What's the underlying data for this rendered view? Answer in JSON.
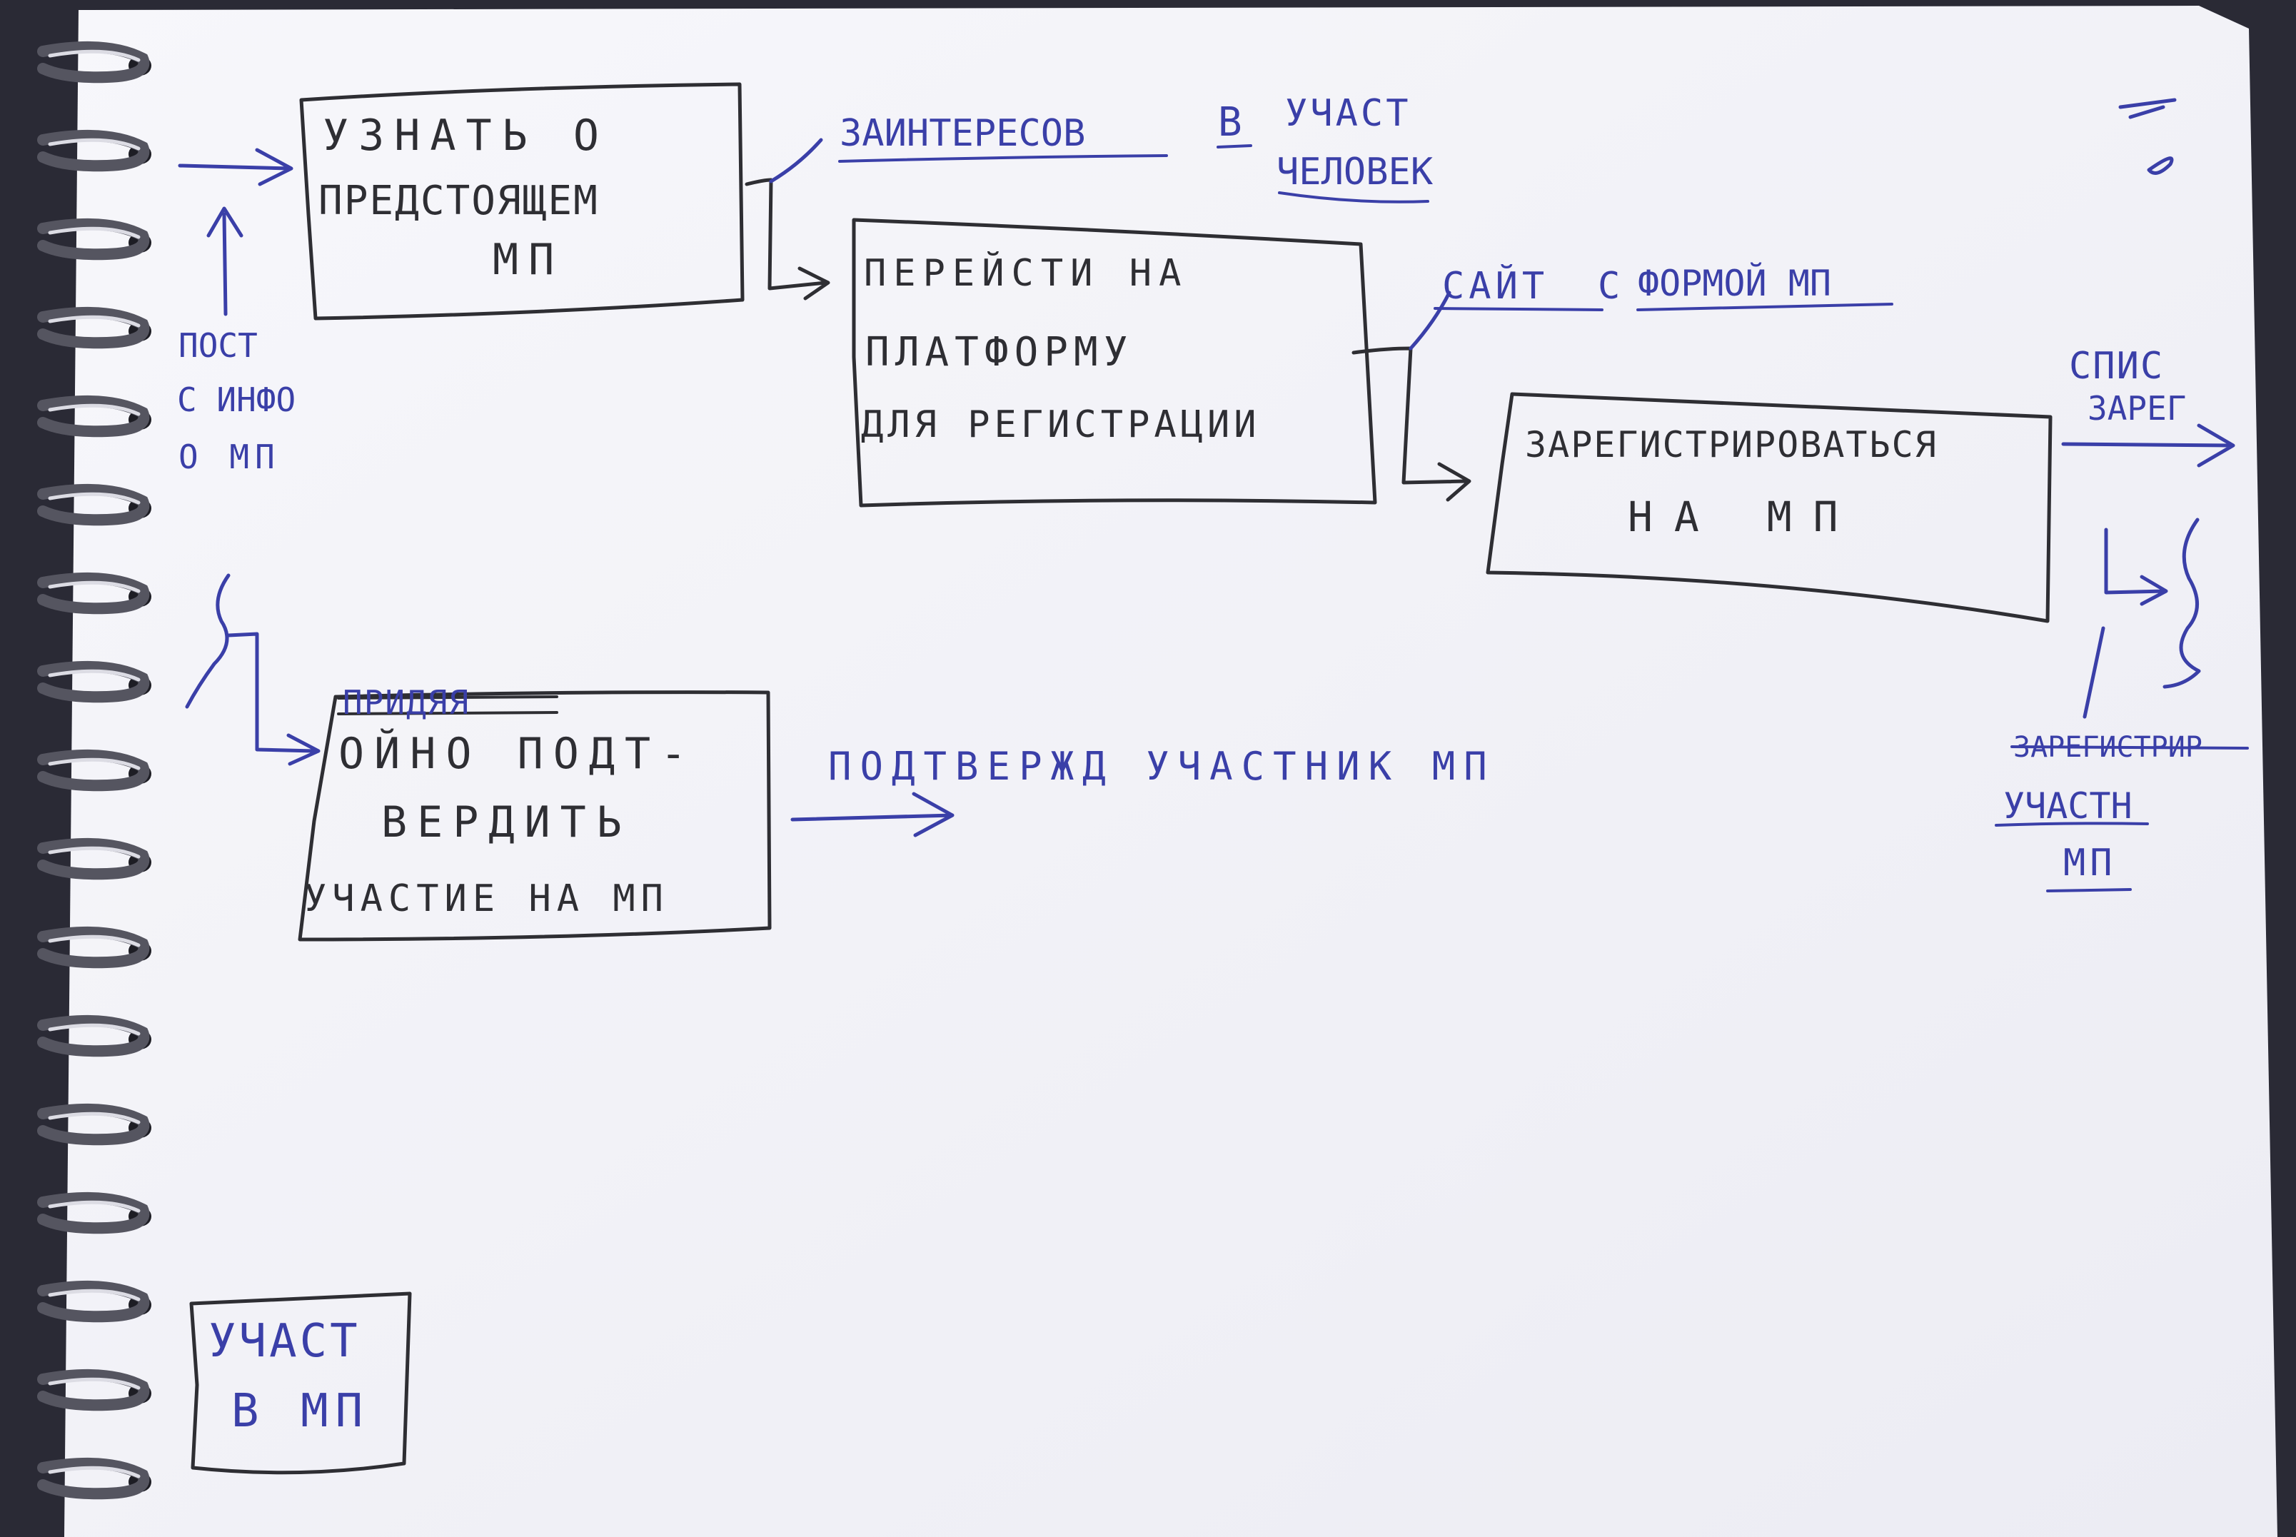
{
  "colors": {
    "paper": "#f3f3f8",
    "black_ink": "#2e2e33",
    "blue_ink": "#3a3fa8",
    "backdrop": "#2a2a35"
  },
  "boxes": {
    "learn": {
      "line1": "УЗНАТЬ О",
      "line2": "ПРЕДСТОЯЩЕМ",
      "line3": "МП"
    },
    "platform": {
      "line1": "ПЕРЕЙСТИ НА",
      "line2": "ПЛАТФОРМУ",
      "line3": "ДЛЯ РЕГИСТРАЦИИ"
    },
    "register": {
      "line1": "ЗАРЕГИСТРИРОВАТЬСЯ",
      "line2": "НА МП"
    },
    "confirm": {
      "struck_word": "ПРИДЯЯ",
      "line1": "ОЙНО ПОДТ-",
      "line2": "ВЕРДИТЬ",
      "line3": "УЧАСТИЕ НА МП"
    },
    "participant": {
      "line1": "УЧАСТ",
      "line2": "В МП"
    }
  },
  "labels": {
    "post_info": {
      "line1": "ПОСТ",
      "line2": "С ИНФО",
      "line3": "О МП"
    },
    "interested": {
      "part1": "ЗАИНТЕРЕСОВ",
      "part2": "В",
      "part3": "УЧАСТ",
      "part4": "ЧЕЛОВЕК"
    },
    "site_form": {
      "part1": "САЙТ",
      "part2": "С",
      "part3": "ФОРМОЙ МП"
    },
    "confirmed": "ПОДТВЕРЖД УЧАСТНИК МП",
    "list_registered": {
      "line1": "СПИС",
      "line2": "ЗАРЕГ"
    },
    "registered_participant": {
      "struck_word": "ЗАРЕГИСТРИР",
      "line1": "УЧАСТН",
      "line2": "МП"
    }
  },
  "corner_marks": {
    "mark1": "≠",
    "mark2": "∅"
  },
  "binding": {
    "rings": 17
  }
}
